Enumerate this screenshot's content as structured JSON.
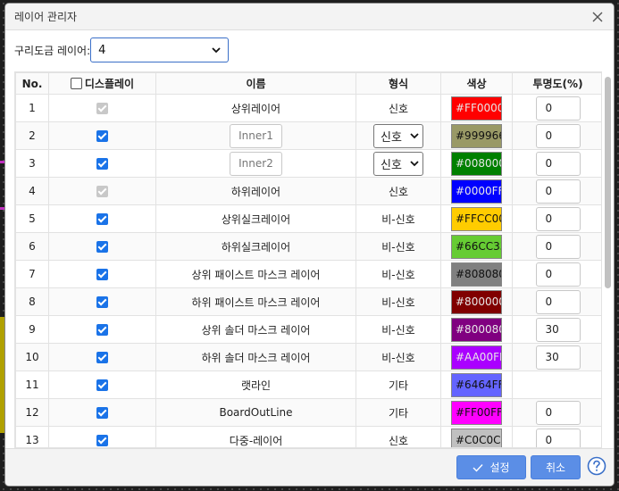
{
  "dialog": {
    "title": "레이어 관리자"
  },
  "layer_select": {
    "label": "구리도금 레이어:",
    "value": "4"
  },
  "table": {
    "headers": {
      "no": "No.",
      "display": "디스플레이",
      "name": "이름",
      "type": "형식",
      "color": "색상",
      "opacity": "투명도(%)"
    },
    "rows": [
      {
        "no": "1",
        "display_checked": true,
        "display_disabled": true,
        "name": "상위레이어",
        "name_editable": false,
        "type": "신호",
        "type_select": false,
        "color": "#FF0000",
        "color_label": "#FF0000",
        "opacity": "0"
      },
      {
        "no": "2",
        "display_checked": true,
        "display_disabled": false,
        "name": "Inner1",
        "name_editable": true,
        "type": "신호",
        "type_select": true,
        "color": "#999966",
        "color_label": "#999966",
        "opacity": "0"
      },
      {
        "no": "3",
        "display_checked": true,
        "display_disabled": false,
        "name": "Inner2",
        "name_editable": true,
        "type": "신호",
        "type_select": true,
        "color": "#008000",
        "color_label": "#008000",
        "opacity": "0"
      },
      {
        "no": "4",
        "display_checked": true,
        "display_disabled": true,
        "name": "하위레이어",
        "name_editable": false,
        "type": "신호",
        "type_select": false,
        "color": "#0000FF",
        "color_label": "#0000FF",
        "opacity": "0"
      },
      {
        "no": "5",
        "display_checked": true,
        "display_disabled": false,
        "name": "상위실크레이어",
        "name_editable": false,
        "type": "비-신호",
        "type_select": false,
        "color": "#FFCC00",
        "color_label": "#FFCC00",
        "opacity": "0"
      },
      {
        "no": "6",
        "display_checked": true,
        "display_disabled": false,
        "name": "하위실크레이어",
        "name_editable": false,
        "type": "비-신호",
        "type_select": false,
        "color": "#66CC33",
        "color_label": "#66CC33",
        "opacity": "0"
      },
      {
        "no": "7",
        "display_checked": true,
        "display_disabled": false,
        "name": "상위 패이스트 마스크 레이어",
        "name_editable": false,
        "type": "비-신호",
        "type_select": false,
        "color": "#808080",
        "color_label": "#808080",
        "opacity": "0"
      },
      {
        "no": "8",
        "display_checked": true,
        "display_disabled": false,
        "name": "하위 패이스트 마스크 레이어",
        "name_editable": false,
        "type": "비-신호",
        "type_select": false,
        "color": "#800000",
        "color_label": "#800000",
        "opacity": "0"
      },
      {
        "no": "9",
        "display_checked": true,
        "display_disabled": false,
        "name": "상위 솔더 마스크 레이어",
        "name_editable": false,
        "type": "비-신호",
        "type_select": false,
        "color": "#800080",
        "color_label": "#800080",
        "opacity": "30"
      },
      {
        "no": "10",
        "display_checked": true,
        "display_disabled": false,
        "name": "하위 솔더 마스크 레이어",
        "name_editable": false,
        "type": "비-신호",
        "type_select": false,
        "color": "#AA00FF",
        "color_label": "#AA00FF",
        "opacity": "30"
      },
      {
        "no": "11",
        "display_checked": true,
        "display_disabled": false,
        "name": "랫라인",
        "name_editable": false,
        "type": "기타",
        "type_select": false,
        "color": "#6464FF",
        "color_label": "#6464FF",
        "opacity": ""
      },
      {
        "no": "12",
        "display_checked": true,
        "display_disabled": false,
        "name": "BoardOutLine",
        "name_editable": false,
        "type": "기타",
        "type_select": false,
        "color": "#FF00FF",
        "color_label": "#FF00FF",
        "opacity": "0"
      },
      {
        "no": "13",
        "display_checked": true,
        "display_disabled": false,
        "name": "다중-레이어",
        "name_editable": false,
        "type": "신호",
        "type_select": false,
        "color": "#C0C0C0",
        "color_label": "#C0C0C0",
        "opacity": "0"
      }
    ]
  },
  "footer": {
    "ok_label": "설정",
    "cancel_label": "취소"
  },
  "colors": {
    "accent": "#1A73E8",
    "button": "#5B8EE6"
  }
}
